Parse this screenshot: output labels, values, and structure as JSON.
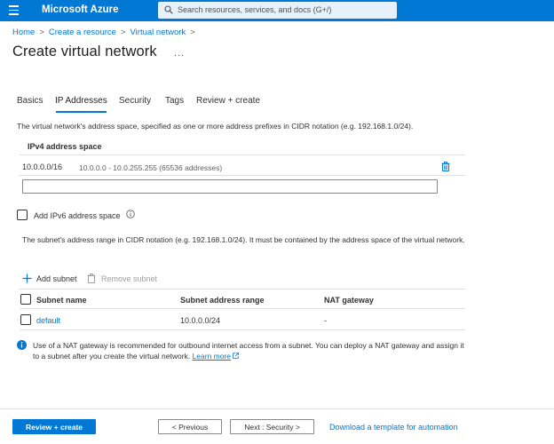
{
  "topbar": {
    "menu_icon": "hamburger-icon",
    "brand": "Microsoft Azure",
    "search_placeholder": "Search resources, services, and docs (G+/)",
    "search_icon": "search-icon",
    "color": "#0078d4"
  },
  "breadcrumb": {
    "items": [
      "Home",
      "Create a resource",
      "Virtual network"
    ],
    "separator": ">"
  },
  "page": {
    "title": "Create virtual network",
    "more": "..."
  },
  "tabs": [
    "Basics",
    "IP Addresses",
    "Security",
    "Tags",
    "Review + create"
  ],
  "active_tab": "IP Addresses",
  "ip_section": {
    "description": "The virtual network's address space, specified as one or more address prefixes in CIDR notation (e.g. 192.168.1.0/24).",
    "ipv4_header": "IPv4 address space",
    "ipv4_entries": [
      {
        "cidr": "10.0.0.0/16",
        "range": "10.0.0.0 - 10.0.255.255 (65536 addresses)"
      }
    ],
    "new_address_value": "",
    "add_ipv6_label": "Add IPv6 address space",
    "add_ipv6_checked": false
  },
  "subnet_section": {
    "description": "The subnet's address range in CIDR notation (e.g. 192.168.1.0/24). It must be contained by the address space of the virtual network.",
    "add_label": "Add subnet",
    "remove_label": "Remove subnet",
    "columns": [
      "Subnet name",
      "Subnet address range",
      "NAT gateway"
    ],
    "rows": [
      {
        "name": "default",
        "range": "10.0.0.0/24",
        "nat": "-"
      }
    ]
  },
  "nat_note": {
    "text": "Use of a NAT gateway is recommended for outbound internet access from a subnet. You can deploy a NAT gateway and assign it to a subnet after you create the virtual network.",
    "link": "Learn more"
  },
  "footer": {
    "review_create": "Review + create",
    "previous": "< Previous",
    "next": "Next : Security >",
    "download": "Download a template for automation"
  },
  "colors": {
    "accent": "#0078d4",
    "text": "#323130",
    "disabled": "#a19f9d"
  }
}
